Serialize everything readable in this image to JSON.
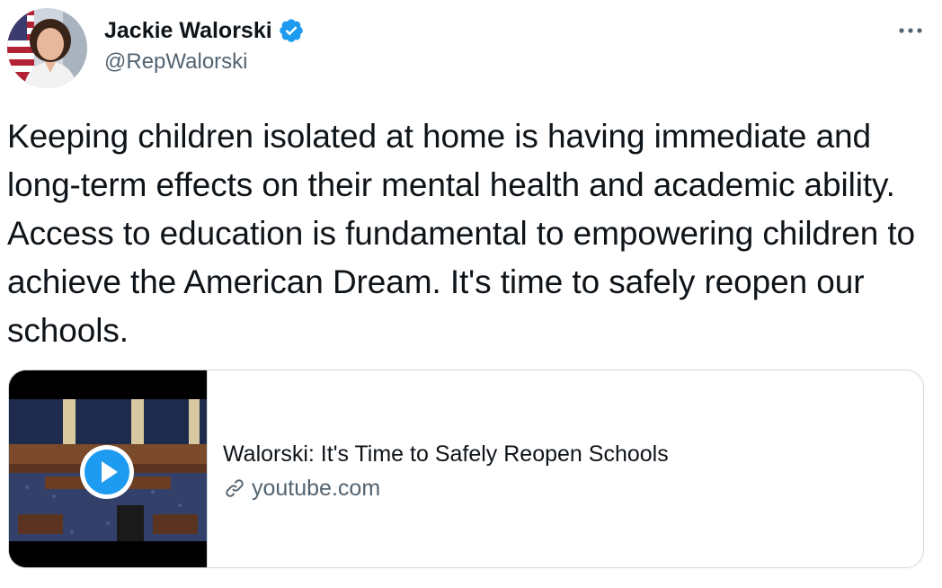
{
  "author": {
    "name": "Jackie Walorski",
    "handle": "@RepWalorski",
    "verified": true
  },
  "tweet": {
    "text": "Keeping children isolated at home is having immediate and long-term effects on their mental health and academic ability. Access to education is fundamental to empowering children to achieve the American Dream. It's time to safely reopen our schools."
  },
  "card": {
    "title": "Walorski: It's Time to Safely Reopen Schools",
    "domain": "youtube.com",
    "thumbnail_icon": "play-icon"
  },
  "icons": {
    "verified": "verified-badge-icon",
    "more": "more-options-icon",
    "link": "link-icon"
  },
  "colors": {
    "accent": "#1d9bf0",
    "text_primary": "#0f1419",
    "text_secondary": "#536471",
    "border": "#cfd9de"
  }
}
